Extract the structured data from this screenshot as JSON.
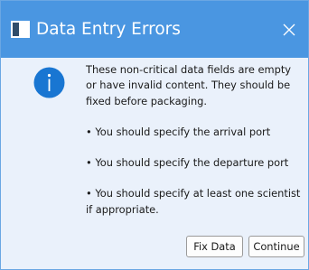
{
  "window": {
    "title": "Data Entry Errors",
    "icon": "app-window-icon",
    "close_icon": "close-icon"
  },
  "message": {
    "icon": "info-icon",
    "intro": "These non-critical data fields are empty or have invalid content. They should be fixed before packaging.",
    "items": [
      "• You should specify the arrival port",
      "• You should specify the departure port",
      "• You should specify at least one scientist if appropriate."
    ]
  },
  "buttons": {
    "fix_label": "Fix Data",
    "continue_label": "Continue"
  },
  "colors": {
    "titlebar": "#4a96e1",
    "body_background": "#eaf1fb",
    "info_icon": "#1976d2"
  }
}
